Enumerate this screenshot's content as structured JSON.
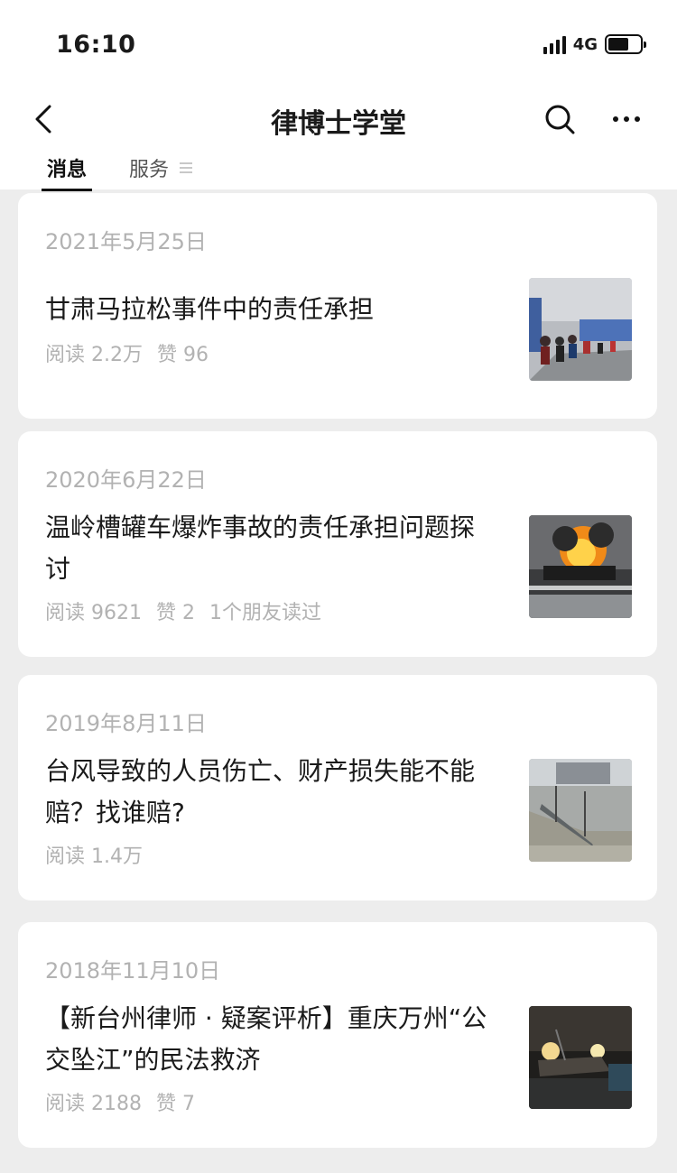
{
  "status": {
    "time": "16:10",
    "network": "4G"
  },
  "nav": {
    "title": "律博士学堂"
  },
  "tabs": {
    "messages": "消息",
    "services": "服务"
  },
  "articles": [
    {
      "date": "2021年5月25日",
      "title": "甘肃马拉松事件中的责任承担",
      "reads": "阅读 2.2万",
      "likes": "赞 96",
      "friends": ""
    },
    {
      "date": "2020年6月22日",
      "title": "温岭槽罐车爆炸事故的责任承担问题探讨",
      "reads": "阅读 9621",
      "likes": "赞 2",
      "friends": "1个朋友读过"
    },
    {
      "date": "2019年8月11日",
      "title": "台风导致的人员伤亡、财产损失能不能赔？找谁赔?",
      "reads": "阅读 1.4万",
      "likes": "",
      "friends": ""
    },
    {
      "date": "2018年11月10日",
      "title": "【新台州律师 · 疑案评析】重庆万州“公交坠江”的民法救济",
      "reads": "阅读 2188",
      "likes": "赞 7",
      "friends": ""
    }
  ]
}
